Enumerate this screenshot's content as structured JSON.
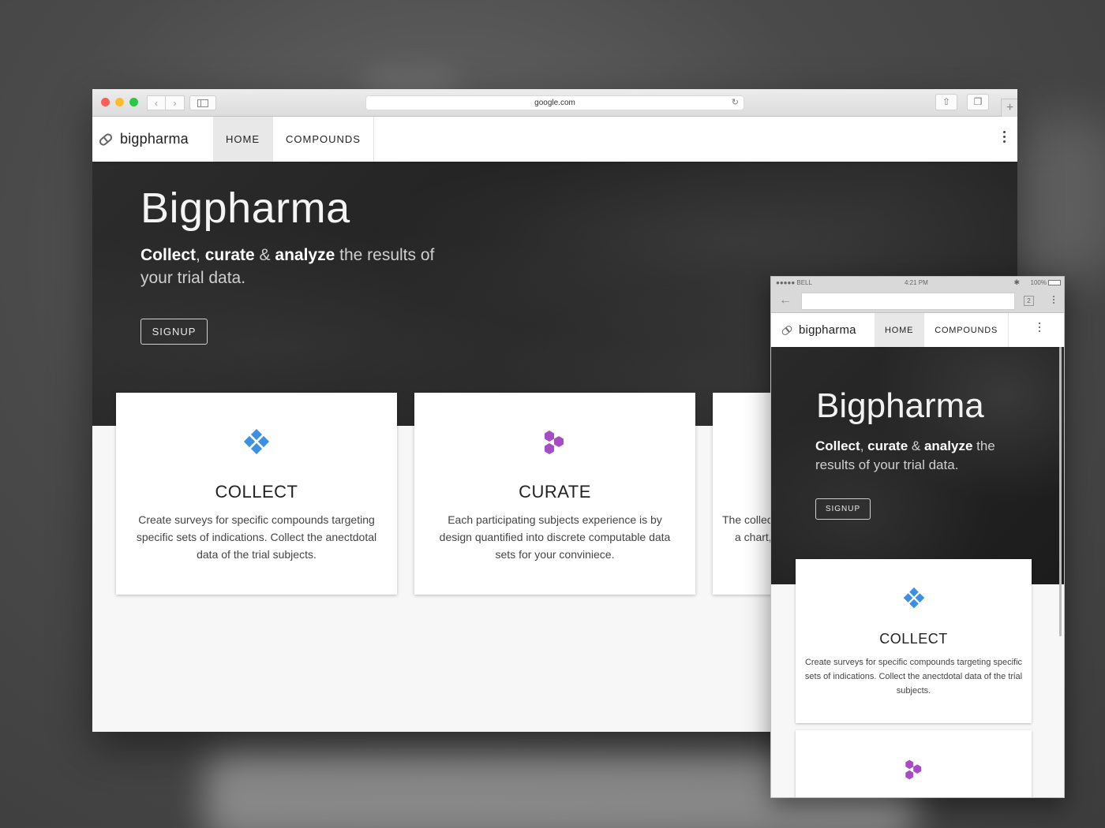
{
  "desktop": {
    "address": "google.com",
    "brand": "bigpharma",
    "tabs": [
      {
        "label": "HOME"
      },
      {
        "label": "COMPOUNDS"
      }
    ],
    "hero": {
      "title": "Bigpharma",
      "sub_collect": "Collect",
      "sub_comma": ", ",
      "sub_curate": "curate",
      "sub_amp": " & ",
      "sub_analyze": "analyze",
      "sub_rest": " the results of your trial data.",
      "signup": "SIGNUP"
    },
    "cards": [
      {
        "title": "COLLECT",
        "text": "Create surveys for specific compounds targeting specific sets of indications. Collect the anectdotal data of the trial subjects.",
        "icon_color": "#3d8fe3"
      },
      {
        "title": "CURATE",
        "text": "Each participating subjects experience is by design quantified into discrete computable data sets for your conviniece.",
        "icon_color": "#a64cc4"
      },
      {
        "text_line1": "The collec",
        "text_line2": "a chart,"
      }
    ]
  },
  "mobile": {
    "carrier": "●●●●● BELL",
    "time": "4:21 PM",
    "battery": "100%",
    "tab_count": "2",
    "brand": "bigpharma",
    "tabs": [
      {
        "label": "HOME"
      },
      {
        "label": "COMPOUNDS"
      }
    ],
    "hero": {
      "title": "Bigpharma",
      "sub_collect": "Collect",
      "sub_comma": ", ",
      "sub_curate": "curate",
      "sub_amp": " & ",
      "sub_analyze": "analyze",
      "sub_rest": " the results of your trial data.",
      "signup": "SIGNUP"
    },
    "cards": [
      {
        "title": "COLLECT",
        "text": "Create surveys for specific compounds targeting specific sets of indications. Collect the anectdotal data of the trial subjects."
      }
    ]
  }
}
